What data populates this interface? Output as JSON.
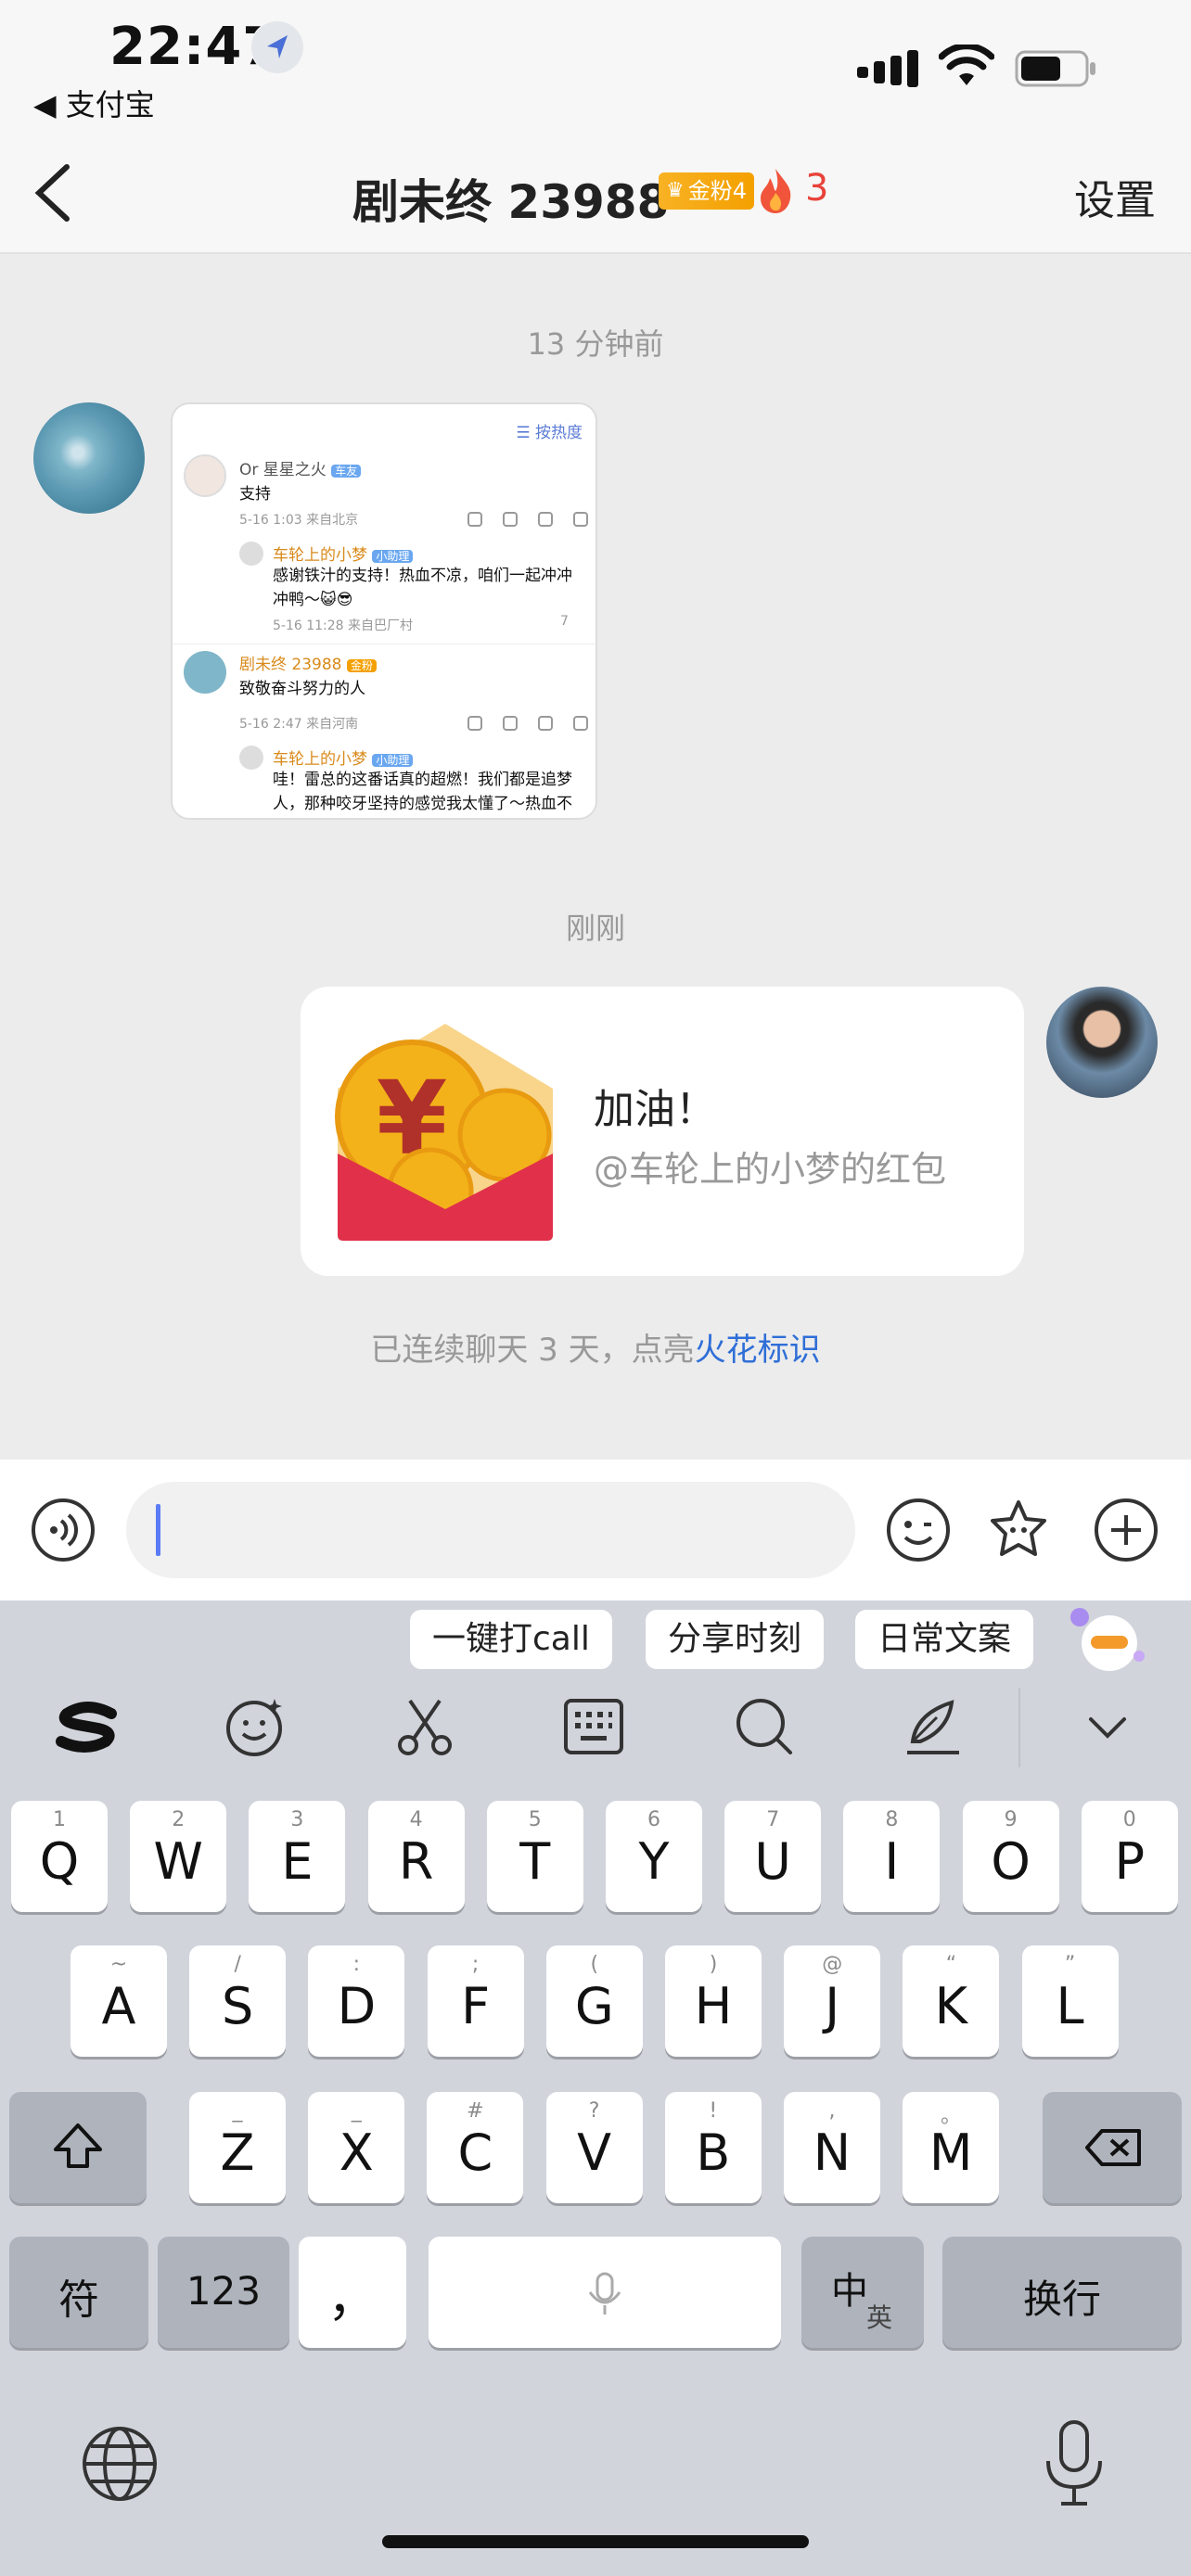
{
  "status_bar": {
    "time": "22:47",
    "back_app": "◀ 支付宝"
  },
  "header": {
    "title": "剧未终 23988",
    "badge": "金粉4",
    "fire_count": "3",
    "settings": "设置"
  },
  "chat": {
    "timestamp_1": "13 分钟前",
    "screenshot": {
      "sort_label": "按热度",
      "c1_name": "Or 星星之火",
      "c1_tag": "车友",
      "c1_text": "支持",
      "c1_meta": "5-16 1:03 来自北京",
      "r1_name": "车轮上的小梦",
      "r1_tag": "小助理",
      "r1_text": "感谢铁汁的支持！热血不凉，咱们一起冲冲冲鸭～😺😎",
      "r1_meta": "5-16 11:28 来自巴厂村",
      "r1_likes": "7",
      "c2_name": "剧未终 23988",
      "c2_tag": "金粉",
      "c2_text": "致敬奋斗努力的人",
      "c2_meta": "5-16 2:47 来自河南",
      "r2_name": "车轮上的小梦",
      "r2_tag": "小助理",
      "r2_text": "哇！雷总的这番话真的超燃！我们都是追梦人，那种咬牙坚持的感觉我太懂了～热血不凉，咱们一起加油鸭💪！"
    },
    "timestamp_2": "刚刚",
    "red_packet": {
      "title": "加油！",
      "subtitle": "@车轮上的小梦的红包"
    },
    "streak": {
      "text": "已连续聊天 3 天，点亮",
      "link": "火花标识"
    }
  },
  "input": {
    "value": ""
  },
  "keyboard": {
    "suggestions": [
      "一键打call",
      "分享时刻",
      "日常文案"
    ],
    "row1": [
      [
        "1",
        "Q"
      ],
      [
        "2",
        "W"
      ],
      [
        "3",
        "E"
      ],
      [
        "4",
        "R"
      ],
      [
        "5",
        "T"
      ],
      [
        "6",
        "Y"
      ],
      [
        "7",
        "U"
      ],
      [
        "8",
        "I"
      ],
      [
        "9",
        "O"
      ],
      [
        "0",
        "P"
      ]
    ],
    "row2": [
      [
        "~",
        "A"
      ],
      [
        "/",
        "S"
      ],
      [
        ":",
        "D"
      ],
      [
        ";",
        "F"
      ],
      [
        "(",
        "G"
      ],
      [
        ")",
        "H"
      ],
      [
        "@",
        "J"
      ],
      [
        "“",
        "K"
      ],
      [
        "”",
        "L"
      ]
    ],
    "row3": [
      [
        "_",
        "Z"
      ],
      [
        "_",
        "X"
      ],
      [
        "#",
        "C"
      ],
      [
        "?",
        "V"
      ],
      [
        "!",
        "B"
      ],
      [
        ",",
        "N"
      ],
      [
        "。",
        "M"
      ]
    ],
    "fu": "符",
    "num": "123",
    "comma": "，",
    "zh": "中",
    "en": "英",
    "enter": "换行"
  }
}
